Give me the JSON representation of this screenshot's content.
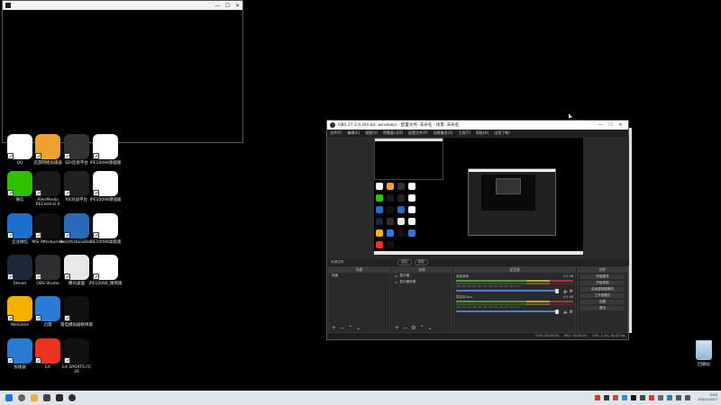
{
  "blank_window": {
    "controls": [
      "—",
      "☐",
      "✕"
    ]
  },
  "obs": {
    "title": "OBS 27.2.4 (64 bit, windows) - 配置文件: 未命名 - 场景: 未命名",
    "window_controls": [
      "—",
      "☐",
      "✕"
    ],
    "menu": [
      "文件(F)",
      "编辑(E)",
      "视图(V)",
      "停靠窗口(D)",
      "配置文件(P)",
      "场景集合(S)",
      "工具(T)",
      "帮助(H)",
      "出错了嗎？"
    ],
    "dock_header": {
      "left": "来源选择",
      "mode": "属性",
      "filter": "滤镜"
    },
    "scenes": {
      "title": "场景",
      "items": [
        "场景"
      ]
    },
    "sources": {
      "title": "来源",
      "items": [
        "显示器",
        "显示器采集"
      ]
    },
    "mixer": {
      "title": "混音器",
      "tracks": [
        {
          "name": "桌面音频",
          "level": "0.0 dB"
        },
        {
          "name": "麦克风/Aux",
          "level": "0.0 dB"
        }
      ],
      "ticks": "-60 -55 -50 -45 -40 -35 -30 -25 -20 -15 -10 -5 0"
    },
    "controls": {
      "title": "控件",
      "buttons": [
        "开始推流",
        "开始录制",
        "启动虚拟摄像机",
        "工作室模式",
        "设置",
        "退出"
      ]
    },
    "status": {
      "live": "LIVE: 00:00:00",
      "rec": "REC: 00:00:00",
      "cpu": "CPU: 1.4%, 60.00 fps"
    }
  },
  "desktop_icons": [
    {
      "label": "QQ",
      "color": "#ffffff"
    },
    {
      "label": "迅游网络加速器",
      "color": "#f0a030"
    },
    {
      "label": "SDI连接平台",
      "color": "#333333"
    },
    {
      "label": "IPE10098基础版",
      "color": "#ffffff"
    },
    {
      "label": "微信",
      "color": "#2dc100"
    },
    {
      "label": "AVerMedia RECentral 4",
      "color": "#1b1b1b"
    },
    {
      "label": "KK对战平台",
      "color": "#222222"
    },
    {
      "label": "IPE10098增强版",
      "color": "#ffffff"
    },
    {
      "label": "企业微信",
      "color": "#1a6fd0"
    },
    {
      "label": "MSI Afterburner",
      "color": "#111111"
    },
    {
      "label": "HearthstoneDe...",
      "color": "#2a6ab8"
    },
    {
      "label": "IPE10098高级版",
      "color": "#ffffff"
    },
    {
      "label": "Steam",
      "color": "#1b2838"
    },
    {
      "label": "OBS Studio",
      "color": "#302e31"
    },
    {
      "label": "腾讯桌面",
      "color": "#e8e8e8"
    },
    {
      "label": "IPE10098_精简版",
      "color": "#ffffff"
    },
    {
      "label": "WeGame",
      "color": "#f6b100"
    },
    {
      "label": "迅雷",
      "color": "#2b7bd8"
    },
    {
      "label": "雷电模拟器精简版",
      "color": "#111111"
    },
    {
      "label": "加速器",
      "color": "#2a7ad4"
    },
    {
      "label": "EA",
      "color": "#ee3322"
    },
    {
      "label": "EA SPORTS FC 26",
      "color": "#111111"
    }
  ],
  "recycle_bin": {
    "label": "回收站"
  },
  "taskbar": {
    "clock_time": "0:00",
    "clock_date": "2025/10/27"
  }
}
